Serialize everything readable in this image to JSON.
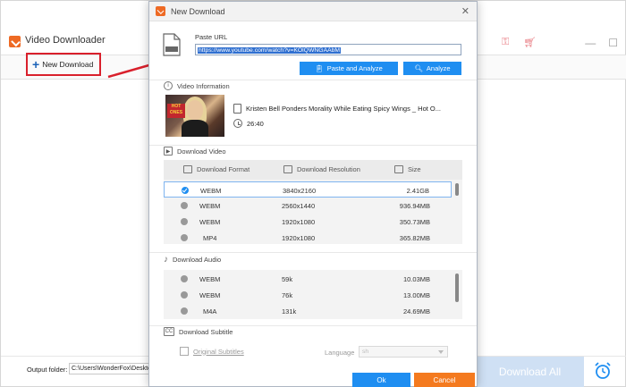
{
  "bg_app": {
    "title": "Video Downloader",
    "new_download_label": "New Download",
    "output_label": "Output folder:",
    "output_path": "C:\\Users\\WonderFox\\Desktop",
    "download_all_label": "Download All",
    "win_min": "—",
    "win_max": "☐"
  },
  "dialog": {
    "title": "New Download",
    "close_glyph": "✕",
    "url": {
      "label": "Paste URL",
      "value": "https://www.youtube.com/watch?v=KOlQWNGAAbM"
    },
    "paste_analyze_label": "Paste and Analyze",
    "analyze_label": "Analyze",
    "video_info": {
      "heading": "Video Information",
      "title": "Kristen Bell Ponders Morality While Eating Spicy Wings _ Hot O...",
      "duration": "26:40",
      "thumb_sign": "HOT ONES"
    },
    "download_video": {
      "heading": "Download Video",
      "columns": [
        "Download Format",
        "Download Resolution",
        "Size"
      ],
      "rows": [
        {
          "format": "WEBM",
          "resolution": "3840x2160",
          "size": "2.41GB",
          "selected": true
        },
        {
          "format": "WEBM",
          "resolution": "2560x1440",
          "size": "936.94MB",
          "selected": false
        },
        {
          "format": "WEBM",
          "resolution": "1920x1080",
          "size": "350.73MB",
          "selected": false
        },
        {
          "format": "MP4",
          "resolution": "1920x1080",
          "size": "365.82MB",
          "selected": false
        }
      ]
    },
    "download_audio": {
      "heading": "Download Audio",
      "rows": [
        {
          "format": "WEBM",
          "bitrate": "59k",
          "size": "10.03MB"
        },
        {
          "format": "WEBM",
          "bitrate": "76k",
          "size": "13.00MB"
        },
        {
          "format": "M4A",
          "bitrate": "131k",
          "size": "24.69MB"
        }
      ]
    },
    "download_subtitle": {
      "heading": "Download Subtitle",
      "original_label": "Original Subtitles",
      "language_label": "Language",
      "language_value": "sh"
    },
    "ok_label": "Ok",
    "cancel_label": "Cancel"
  },
  "colors": {
    "accent_blue": "#1f8ef1",
    "cancel_orange": "#f47a1f",
    "highlight_red": "#d9202c",
    "brand_orange": "#ee6a24"
  }
}
